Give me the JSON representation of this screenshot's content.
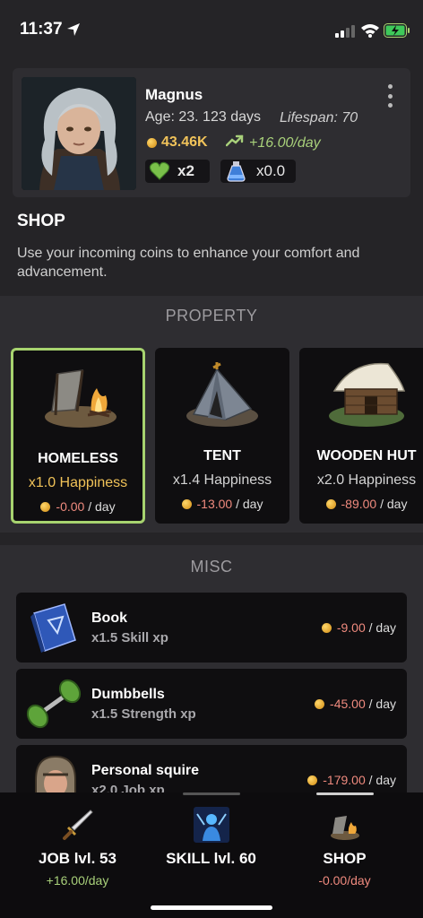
{
  "status_bar": {
    "time": "11:37"
  },
  "player": {
    "name": "Magnus",
    "age": "Age: 23. 123 days",
    "lifespan": "Lifespan: 70",
    "coins": "43.46K",
    "income": "+16.00/day",
    "happiness_multiplier": "x2",
    "potion_value": "x0.0"
  },
  "shop": {
    "title": "SHOP",
    "description": "Use your incoming coins to enhance your comfort and advancement."
  },
  "property": {
    "title": "PROPERTY",
    "items": [
      {
        "name": "HOMELESS",
        "happiness": "x1.0 Happiness",
        "cost": "-0.00",
        "per_day": "/ day",
        "selected": true
      },
      {
        "name": "TENT",
        "happiness": "x1.4 Happiness",
        "cost": "-13.00",
        "per_day": "/ day",
        "selected": false
      },
      {
        "name": "WOODEN HUT",
        "happiness": "x2.0 Happiness",
        "cost": "-89.00",
        "per_day": "/ day",
        "selected": false
      }
    ]
  },
  "misc": {
    "title": "MISC",
    "items": [
      {
        "name": "Book",
        "effect": "x1.5 Skill xp",
        "cost": "-9.00",
        "per_day": "/ day"
      },
      {
        "name": "Dumbbells",
        "effect": "x1.5 Strength xp",
        "cost": "-45.00",
        "per_day": "/ day"
      },
      {
        "name": "Personal squire",
        "effect": "x2.0 Job xp",
        "cost": "-179.00",
        "per_day": "/ day"
      }
    ]
  },
  "nav": {
    "tabs": [
      {
        "label": "JOB lvl. 53",
        "rate": "+16.00/day"
      },
      {
        "label": "SKILL lvl. 60",
        "rate": ""
      },
      {
        "label": "SHOP",
        "rate": "-0.00/day"
      }
    ]
  },
  "colors": {
    "background": "#252427",
    "card": "#2e2d31",
    "selected_border": "#a7d36f",
    "gold": "#f1c35a",
    "positive": "#a8d07a",
    "negative": "#ef8a7e"
  },
  "icons": [
    "location-arrow-icon",
    "cellular-signal-icon",
    "wifi-icon",
    "battery-charging-icon",
    "more-vertical-icon",
    "coin-icon",
    "trend-up-icon",
    "heart-icon",
    "potion-icon",
    "sword-icon",
    "skill-icon",
    "shop-icon"
  ]
}
